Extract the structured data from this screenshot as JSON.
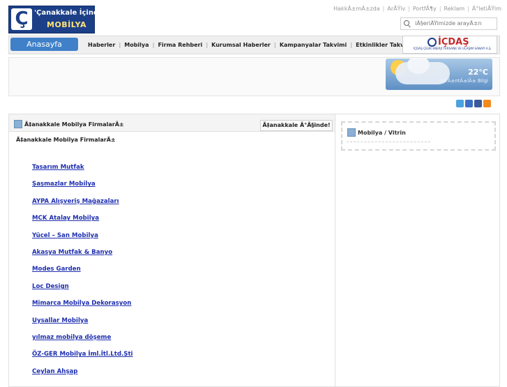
{
  "logo": {
    "mark": "Ç",
    "line1": "'Çanakkale İçinde'",
    "line2": "MOBİLYA"
  },
  "toplinks": [
    "HakkÄ±mÄ±zda",
    "ArÅŸiv",
    "PortfÃ¶y",
    "Reklam",
    "Ä°letiÅŸim"
  ],
  "search": {
    "placeholder": "iÃ§eriÄŸimizde arayÄ±n",
    "icon": "search-icon"
  },
  "nav": {
    "home": "Anasayfa",
    "items": [
      "Haberler",
      "Mobilya",
      "Firma Rehberi",
      "Kurumsal Haberler",
      "Kampanyalar Takvimi",
      "Etkinlikler Takvimi"
    ]
  },
  "brand": {
    "name": "İÇDAŞ",
    "sub": "İÇDAŞ ÇELİK ENERJİ TERSANE VE ULAŞIM SANAYİ A.Ş."
  },
  "weather": {
    "temp": "22°C",
    "link": "AyrÄ±ntÄ±lÄ± Bilgi"
  },
  "social": [
    {
      "icon": "twitter-icon",
      "color": "#4aa3df"
    },
    {
      "icon": "delicious-icon",
      "color": "#3b6fc4"
    },
    {
      "icon": "facebook-icon",
      "color": "#3b5998"
    },
    {
      "icon": "rss-icon",
      "color": "#f28b1e"
    }
  ],
  "main": {
    "title": "Ã‡anakkale Mobilya FirmalarÄ±",
    "button": "Ã‡anakkale Ä°Ã§inde!",
    "crumb": "Ã‡anakkale Mobilya FirmalarÄ±",
    "companies": [
      "Tasarım Mutfak",
      "Şaşmazlar Mobilya",
      "AYPA Alışveriş Mağazaları",
      "MCK Atalay Mobilya",
      "Yücel – San Mobilya",
      "Akasya Mutfak & Banyo",
      "Modes Garden",
      "Loc Design",
      "Mimarca Mobilya Dekorasyon",
      "Uysallar Mobilya",
      "yılmaz mobilya döşeme",
      "ÖZ-GER Mobilya İml.İtl.Ltd.Şti",
      "Ceylan Ahşap"
    ]
  },
  "side": {
    "title": "Mobilya / Vitrin"
  }
}
